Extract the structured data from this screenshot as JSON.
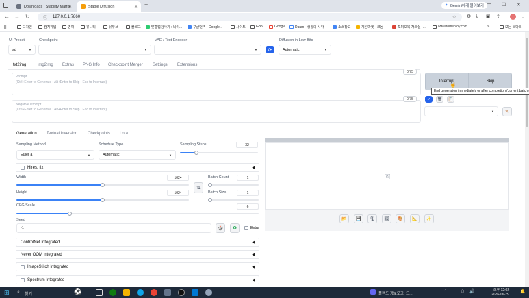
{
  "browser": {
    "tabs": [
      {
        "label": "Downloads | Stability Matrix",
        "close": "✕"
      },
      {
        "label": "Stable Diffusion",
        "close": "✕"
      }
    ],
    "new_tab": "+",
    "url": "127.0.0.1:7860",
    "gemini_button": "Gemini에게 물어보기",
    "bookmarks": [
      "디자인",
      "컴지작업",
      "영어",
      "유니티",
      "유튜브",
      "블로그",
      "맞춤법검사기 : 네이...",
      "구글번역 - Google...",
      "사이트",
      "GBS",
      "Google",
      "Daum - 생활의 시작",
      "소스창고",
      "게임마켓 - 크몽",
      "포미오북 차트실 -...",
      "www.tomentoy.com"
    ],
    "all_bookmarks": "모든 북마크"
  },
  "top_settings": {
    "ui_preset_label": "UI Preset",
    "ui_preset_value": "sd",
    "checkpoint_label": "Checkpoint",
    "checkpoint_value": "",
    "vae_label": "VAE / Text Encoder",
    "vae_value": "",
    "diffusion_label": "Diffusion in Low Bits",
    "diffusion_value": "Automatic"
  },
  "main_tabs": [
    "txt2img",
    "img2img",
    "Extras",
    "PNG Info",
    "Checkpoint Merger",
    "Settings",
    "Extensions"
  ],
  "prompt": {
    "label": "Prompt",
    "hint": "(Ctrl+Enter to Generate ; Alt+Enter to Skip ; Esc to Interrupt)",
    "counter": "0/75"
  },
  "negative_prompt": {
    "label": "Negative Prompt",
    "hint": "(Ctrl+Enter to Generate ; Alt+Enter to Skip ; Esc to Interrupt)",
    "counter": "0/75"
  },
  "actions": {
    "interrupt": "Interrupt",
    "skip": "Skip",
    "tooltip": "End generation immediately or after completion (current batch)"
  },
  "gen_tabs": [
    "Generation",
    "Textual Inversion",
    "Checkpoints",
    "Lora"
  ],
  "generation": {
    "sampling_method_label": "Sampling Method",
    "sampling_method_value": "Euler a",
    "schedule_type_label": "Schedule Type",
    "schedule_type_value": "Automatic",
    "sampling_steps_label": "Sampling Steps",
    "sampling_steps_value": "32",
    "sampling_steps_fraction": 0.21,
    "hires_label": "Hires. fix",
    "width_label": "Width",
    "width_value": "1024",
    "width_fraction": 0.5,
    "height_label": "Height",
    "height_value": "1024",
    "height_fraction": 0.5,
    "batch_count_label": "Batch Count",
    "batch_count_value": "1",
    "batch_size_label": "Batch Size",
    "batch_size_value": "1",
    "cfg_label": "CFG Scale",
    "cfg_value": "6",
    "cfg_fraction": 0.22,
    "seed_label": "Seed",
    "seed_value": "-1",
    "extra_label": "Extra"
  },
  "accordions": [
    "ControlNet Integrated",
    "Never OOM Integrated",
    "ImageStitch Integrated",
    "Spectrum Integrated"
  ],
  "taskbar": {
    "search": "찾기",
    "notification": "플랜드 광보모고: 드...",
    "time": "오후 12:02",
    "date": "2026-06-25"
  },
  "colors": {
    "accent": "#3b82f6",
    "interrupt_bg": "#c9d1db",
    "taskbar": "#1e2a3a"
  }
}
